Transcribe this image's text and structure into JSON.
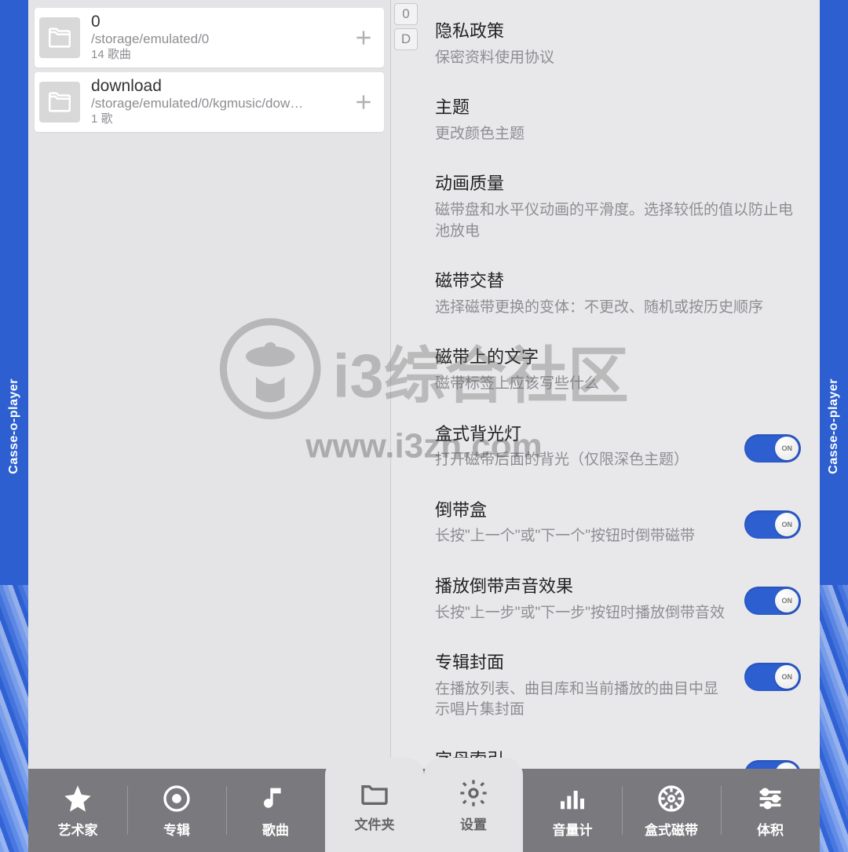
{
  "app_name": "Casse-o-player",
  "left_panel": {
    "folders": [
      {
        "name": "0",
        "path": "/storage/emulated/0",
        "count": "14 歌曲"
      },
      {
        "name": "download",
        "path": "/storage/emulated/0/kgmusic/dow…",
        "count": "1 歌"
      }
    ]
  },
  "index_rail": [
    "0",
    "D"
  ],
  "settings": [
    {
      "title": "隐私政策",
      "desc": "保密资料使用协议",
      "toggle": null
    },
    {
      "title": "主题",
      "desc": "更改颜色主题",
      "toggle": null
    },
    {
      "title": "动画质量",
      "desc": "磁带盘和水平仪动画的平滑度。选择较低的值以防止电池放电",
      "toggle": null
    },
    {
      "title": "磁带交替",
      "desc": "选择磁带更换的变体：不更改、随机或按历史顺序",
      "toggle": null
    },
    {
      "title": "磁带上的文字",
      "desc": "磁带标签上应该写些什么",
      "toggle": null
    },
    {
      "title": "盒式背光灯",
      "desc": "打开磁带后面的背光（仅限深色主题）",
      "toggle": "ON"
    },
    {
      "title": "倒带盒",
      "desc": "长按\"上一个\"或\"下一个\"按钮时倒带磁带",
      "toggle": "ON"
    },
    {
      "title": "播放倒带声音效果",
      "desc": "长按\"上一步\"或\"下一步\"按钮时播放倒带音效",
      "toggle": "ON"
    },
    {
      "title": "专辑封面",
      "desc": "在播放列表、曲目库和当前播放的曲目中显示唱片集封面",
      "toggle": "ON"
    },
    {
      "title": "字母索引",
      "desc": "",
      "toggle": "ON"
    }
  ],
  "tabs": [
    {
      "id": "artist",
      "label": "艺术家",
      "icon": "star",
      "active": false
    },
    {
      "id": "album",
      "label": "专辑",
      "icon": "disc",
      "active": false
    },
    {
      "id": "song",
      "label": "歌曲",
      "icon": "note",
      "active": false
    },
    {
      "id": "folder",
      "label": "文件夹",
      "icon": "folder",
      "active": true
    },
    {
      "id": "settings",
      "label": "设置",
      "icon": "gear",
      "active": true
    },
    {
      "id": "vu",
      "label": "音量计",
      "icon": "eq",
      "active": false
    },
    {
      "id": "cassette",
      "label": "盒式磁带",
      "icon": "reel",
      "active": false
    },
    {
      "id": "volume",
      "label": "体积",
      "icon": "sliders",
      "active": false
    }
  ],
  "watermark": {
    "title": "i3综合社区",
    "url": "www.i3zh.com"
  },
  "toggle_on_label": "ON"
}
